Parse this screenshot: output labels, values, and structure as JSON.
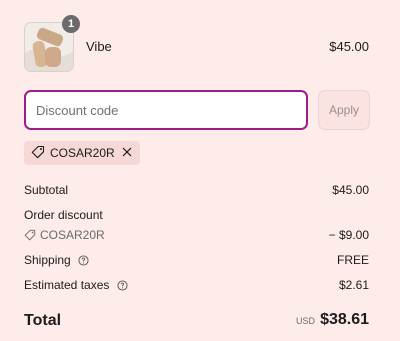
{
  "product": {
    "name": "Vibe",
    "price": "$45.00",
    "quantity_badge": "1",
    "image_icon": "product-thumbnail"
  },
  "discount": {
    "placeholder": "Discount code",
    "value": "",
    "apply_label": "Apply",
    "applied_code": "COSAR20R",
    "tag_icon": "tag-icon",
    "remove_icon": "close-icon"
  },
  "summary": {
    "subtotal_label": "Subtotal",
    "subtotal_value": "$45.00",
    "order_discount_label": "Order discount",
    "order_discount_code": "COSAR20R",
    "order_discount_value": "− $9.00",
    "shipping_label": "Shipping",
    "shipping_value": "FREE",
    "taxes_label": "Estimated taxes",
    "taxes_value": "$2.61"
  },
  "total": {
    "label": "Total",
    "currency": "USD",
    "value": "$38.61"
  },
  "colors": {
    "background": "#fdecea",
    "accent": "#9b1d86",
    "tag_background": "#f6d8d6"
  }
}
